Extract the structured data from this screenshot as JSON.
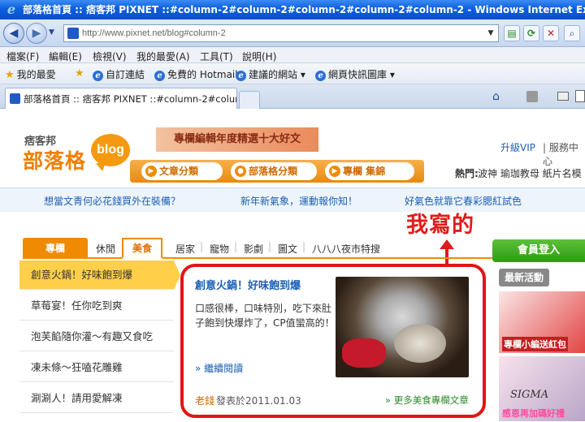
{
  "window": {
    "title": "部落格首頁 :: 痞客邦 PIXNET ::#column-2#column-2#column-2#column-2#column-2 - Windows Internet Explorer"
  },
  "address": {
    "url": "http://www.pixnet.net/blog#column-2"
  },
  "menu": [
    "檔案(F)",
    "編輯(E)",
    "檢視(V)",
    "我的最愛(A)",
    "工具(T)",
    "說明(H)"
  ],
  "favorites": {
    "main": "我的最愛",
    "items": [
      "自訂連結",
      "免費的 Hotmail",
      "建議的網站 ▾",
      "網頁快訊圖庫 ▾"
    ]
  },
  "tab": {
    "title": "部落格首頁 :: 痞客邦 PIXNET ::#column-2#column-..."
  },
  "site": {
    "logo_small": "痞客邦",
    "logo_big": "部落格",
    "logo_bubble": "blog",
    "banner": "專欄編輯年度精選十大好文",
    "upgrade_vip": "升級VIP",
    "service": "| 服務中心",
    "nav": [
      "文章分類",
      "部落格分類",
      "專欄 集錦"
    ],
    "hot_label": "熱門:",
    "hot_text": "波神 瑜珈教母 紙片名模 車"
  },
  "links": [
    "想當文青何必花錢買外在裝備？",
    "新年新氣象，運動報你知！",
    "好氣色就靠它春彩腮紅試色"
  ],
  "annotation": "我寫的",
  "category_tabs": {
    "special": "專欄",
    "leisure": "休閒",
    "food": "美食",
    "others": [
      "居家",
      "寵物",
      "影劇",
      "圖文",
      "八八八夜市特搜"
    ]
  },
  "articles": [
    "創意火鍋！好味飽到爆",
    "草莓宴！任你吃到爽",
    "泡芙餡隨你灌～有趣又食吃",
    "凍未條～狂嗑花雕雞",
    "涮涮人！請用愛解凍"
  ],
  "feature": {
    "title": "創意火鍋！好味飽到爆",
    "desc": "口感很棒，口味特別，吃下來肚子飽到快爆炸了，CP值蠻高的！",
    "read_more": "» 繼續閱讀",
    "author": "老錢",
    "date": "發表於2011.01.03",
    "more": "» 更多美食專欄文章"
  },
  "sidebar": {
    "login": "會員登入",
    "latest": "最新活動",
    "event1": "專欄小編送紅包",
    "event2_sig": "SIGMA",
    "event2": "感恩再加碼好禮"
  },
  "icons": {
    "back": "back-arrow-icon",
    "forward": "forward-arrow-icon",
    "refresh": "refresh-icon",
    "stop": "stop-icon",
    "home": "home-icon",
    "feed": "rss-icon",
    "print": "print-icon"
  }
}
